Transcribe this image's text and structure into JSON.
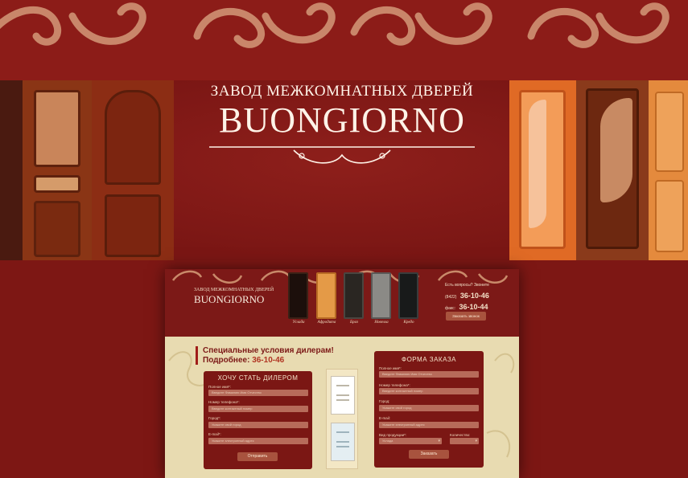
{
  "hero": {
    "subtitle": "ЗАВОД МЕЖКОМНАТНЫХ ДВЕРЕЙ",
    "brand": "BUONGIORNO"
  },
  "site": {
    "logo_sub": "ЗАВОД МЕЖКОМНАТНЫХ ДВЕРЕЙ",
    "logo": "BUONGIORNO",
    "doors": [
      "Услада",
      "Афродита",
      "Бриз",
      "Новелла",
      "Кредо"
    ],
    "contact": {
      "caption": "Есть вопросы? Звоните",
      "code": "(8422)",
      "phone1": "36-10-46",
      "fax_label": "факс:",
      "phone2": "36-10-44",
      "callback": "Заказать звонок"
    },
    "dealer": {
      "line1": "Специальные условия дилерам!",
      "line2_prefix": "Подробнее: ",
      "phone": "36-10-46"
    },
    "dealer_form": {
      "title": "ХОЧУ СТАТЬ ДИЛЕРОМ",
      "name_label": "Полное имя*:",
      "name_placeholder": "Введите Фамилию Имя Отчество",
      "phone_label": "Номер телефона*:",
      "phone_placeholder": "Введите контактный номер",
      "city_label": "Город*:",
      "city_placeholder": "Укажите свой город",
      "email_label": "E-mail*:",
      "email_placeholder": "Укажите электронный адрес",
      "submit": "Отправить"
    },
    "order_form": {
      "title": "ФОРМА ЗАКАЗА",
      "name_label": "Полное имя*:",
      "name_placeholder": "Введите Фамилию Имя Отчество",
      "phone_label": "Номер телефона*:",
      "phone_placeholder": "Введите контактный номер",
      "city_label": "Город:",
      "city_placeholder": "Укажите свой город",
      "email_label": "E-mail:",
      "email_placeholder": "Укажите электронный адрес",
      "product_label": "Вид продукции*:",
      "product_value": "Услада",
      "qty_label": "Количество:",
      "qty_value": "",
      "submit": "Заказать"
    }
  },
  "colors": {
    "background": "#7a1614",
    "accent": "#a8533e",
    "cream": "#e8dbb1"
  }
}
